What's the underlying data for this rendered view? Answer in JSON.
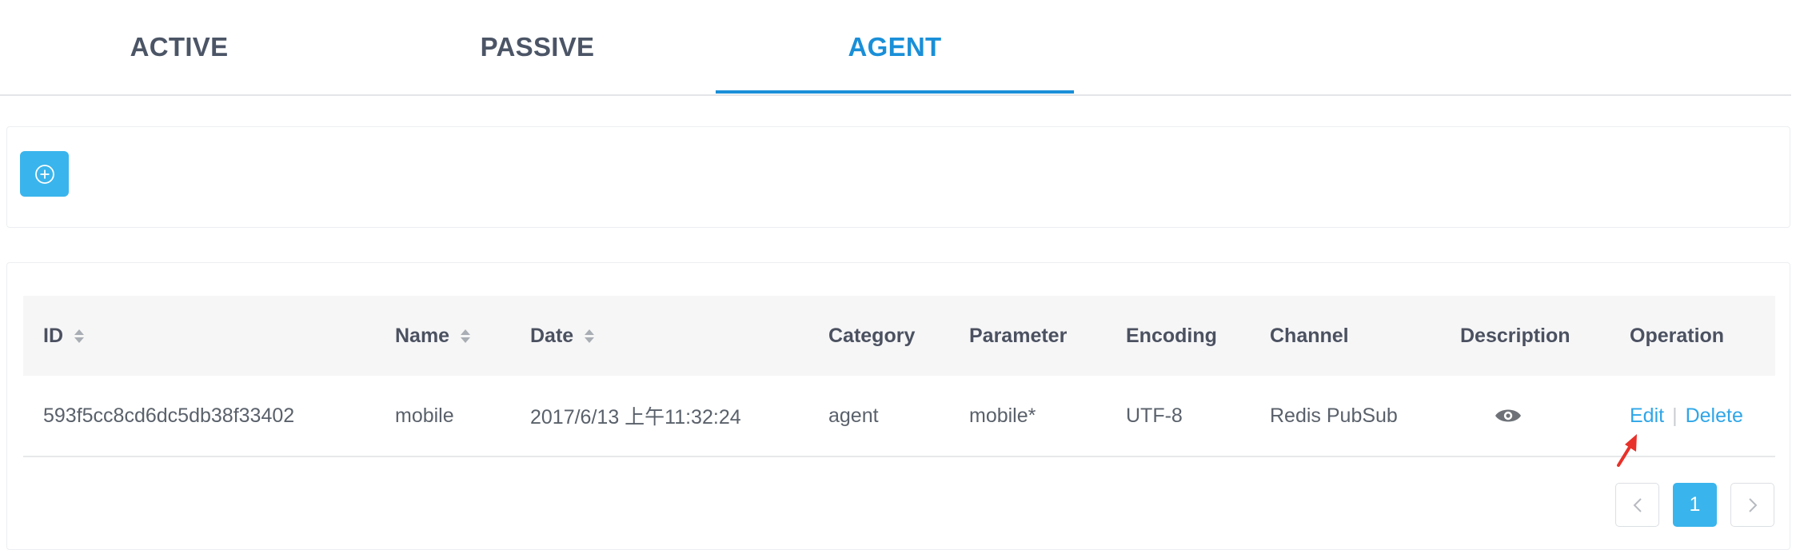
{
  "tabs": [
    {
      "label": "ACTIVE"
    },
    {
      "label": "PASSIVE"
    },
    {
      "label": "AGENT"
    }
  ],
  "toolbar": {
    "add_icon": "plus-circle-icon"
  },
  "table": {
    "columns": [
      "ID",
      "Name",
      "Date",
      "Category",
      "Parameter",
      "Encoding",
      "Channel",
      "Description",
      "Operation"
    ],
    "rows": [
      {
        "id": "593f5cc8cd6dc5db38f33402",
        "name": "mobile",
        "date": "2017/6/13 上午11:32:24",
        "category": "agent",
        "parameter": "mobile*",
        "encoding": "UTF-8",
        "channel": "Redis PubSub",
        "description_icon": "eye-icon",
        "edit_label": "Edit",
        "separator": "|",
        "delete_label": "Delete"
      }
    ]
  },
  "pagination": {
    "prev_icon": "chevron-left-icon",
    "current_page": "1",
    "next_icon": "chevron-right-icon"
  },
  "colors": {
    "accent": "#1a8fd8",
    "button": "#3ab4ec",
    "link": "#2fa6e8",
    "annotation": "#e8312a"
  }
}
